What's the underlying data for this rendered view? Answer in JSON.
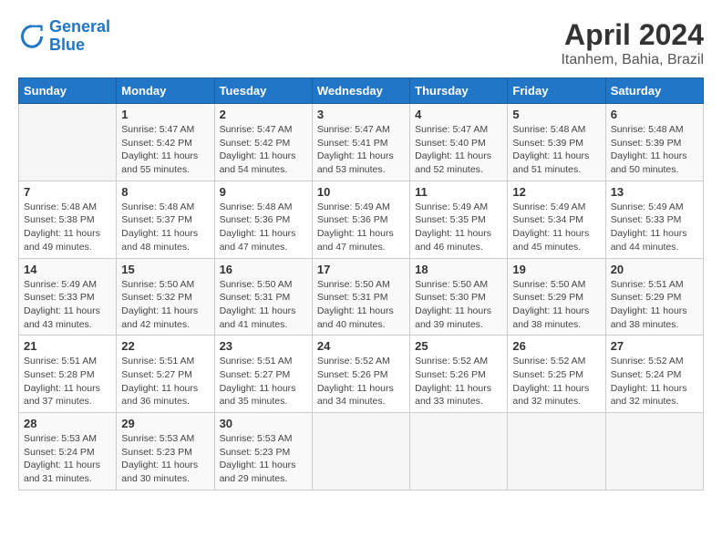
{
  "logo": {
    "line1": "General",
    "line2": "Blue"
  },
  "title": "April 2024",
  "subtitle": "Itanhem, Bahia, Brazil",
  "days_header": [
    "Sunday",
    "Monday",
    "Tuesday",
    "Wednesday",
    "Thursday",
    "Friday",
    "Saturday"
  ],
  "weeks": [
    [
      {
        "num": "",
        "info": ""
      },
      {
        "num": "1",
        "info": "Sunrise: 5:47 AM\nSunset: 5:42 PM\nDaylight: 11 hours\nand 55 minutes."
      },
      {
        "num": "2",
        "info": "Sunrise: 5:47 AM\nSunset: 5:42 PM\nDaylight: 11 hours\nand 54 minutes."
      },
      {
        "num": "3",
        "info": "Sunrise: 5:47 AM\nSunset: 5:41 PM\nDaylight: 11 hours\nand 53 minutes."
      },
      {
        "num": "4",
        "info": "Sunrise: 5:47 AM\nSunset: 5:40 PM\nDaylight: 11 hours\nand 52 minutes."
      },
      {
        "num": "5",
        "info": "Sunrise: 5:48 AM\nSunset: 5:39 PM\nDaylight: 11 hours\nand 51 minutes."
      },
      {
        "num": "6",
        "info": "Sunrise: 5:48 AM\nSunset: 5:39 PM\nDaylight: 11 hours\nand 50 minutes."
      }
    ],
    [
      {
        "num": "7",
        "info": "Sunrise: 5:48 AM\nSunset: 5:38 PM\nDaylight: 11 hours\nand 49 minutes."
      },
      {
        "num": "8",
        "info": "Sunrise: 5:48 AM\nSunset: 5:37 PM\nDaylight: 11 hours\nand 48 minutes."
      },
      {
        "num": "9",
        "info": "Sunrise: 5:48 AM\nSunset: 5:36 PM\nDaylight: 11 hours\nand 47 minutes."
      },
      {
        "num": "10",
        "info": "Sunrise: 5:49 AM\nSunset: 5:36 PM\nDaylight: 11 hours\nand 47 minutes."
      },
      {
        "num": "11",
        "info": "Sunrise: 5:49 AM\nSunset: 5:35 PM\nDaylight: 11 hours\nand 46 minutes."
      },
      {
        "num": "12",
        "info": "Sunrise: 5:49 AM\nSunset: 5:34 PM\nDaylight: 11 hours\nand 45 minutes."
      },
      {
        "num": "13",
        "info": "Sunrise: 5:49 AM\nSunset: 5:33 PM\nDaylight: 11 hours\nand 44 minutes."
      }
    ],
    [
      {
        "num": "14",
        "info": "Sunrise: 5:49 AM\nSunset: 5:33 PM\nDaylight: 11 hours\nand 43 minutes."
      },
      {
        "num": "15",
        "info": "Sunrise: 5:50 AM\nSunset: 5:32 PM\nDaylight: 11 hours\nand 42 minutes."
      },
      {
        "num": "16",
        "info": "Sunrise: 5:50 AM\nSunset: 5:31 PM\nDaylight: 11 hours\nand 41 minutes."
      },
      {
        "num": "17",
        "info": "Sunrise: 5:50 AM\nSunset: 5:31 PM\nDaylight: 11 hours\nand 40 minutes."
      },
      {
        "num": "18",
        "info": "Sunrise: 5:50 AM\nSunset: 5:30 PM\nDaylight: 11 hours\nand 39 minutes."
      },
      {
        "num": "19",
        "info": "Sunrise: 5:50 AM\nSunset: 5:29 PM\nDaylight: 11 hours\nand 38 minutes."
      },
      {
        "num": "20",
        "info": "Sunrise: 5:51 AM\nSunset: 5:29 PM\nDaylight: 11 hours\nand 38 minutes."
      }
    ],
    [
      {
        "num": "21",
        "info": "Sunrise: 5:51 AM\nSunset: 5:28 PM\nDaylight: 11 hours\nand 37 minutes."
      },
      {
        "num": "22",
        "info": "Sunrise: 5:51 AM\nSunset: 5:27 PM\nDaylight: 11 hours\nand 36 minutes."
      },
      {
        "num": "23",
        "info": "Sunrise: 5:51 AM\nSunset: 5:27 PM\nDaylight: 11 hours\nand 35 minutes."
      },
      {
        "num": "24",
        "info": "Sunrise: 5:52 AM\nSunset: 5:26 PM\nDaylight: 11 hours\nand 34 minutes."
      },
      {
        "num": "25",
        "info": "Sunrise: 5:52 AM\nSunset: 5:26 PM\nDaylight: 11 hours\nand 33 minutes."
      },
      {
        "num": "26",
        "info": "Sunrise: 5:52 AM\nSunset: 5:25 PM\nDaylight: 11 hours\nand 32 minutes."
      },
      {
        "num": "27",
        "info": "Sunrise: 5:52 AM\nSunset: 5:24 PM\nDaylight: 11 hours\nand 32 minutes."
      }
    ],
    [
      {
        "num": "28",
        "info": "Sunrise: 5:53 AM\nSunset: 5:24 PM\nDaylight: 11 hours\nand 31 minutes."
      },
      {
        "num": "29",
        "info": "Sunrise: 5:53 AM\nSunset: 5:23 PM\nDaylight: 11 hours\nand 30 minutes."
      },
      {
        "num": "30",
        "info": "Sunrise: 5:53 AM\nSunset: 5:23 PM\nDaylight: 11 hours\nand 29 minutes."
      },
      {
        "num": "",
        "info": ""
      },
      {
        "num": "",
        "info": ""
      },
      {
        "num": "",
        "info": ""
      },
      {
        "num": "",
        "info": ""
      }
    ]
  ]
}
